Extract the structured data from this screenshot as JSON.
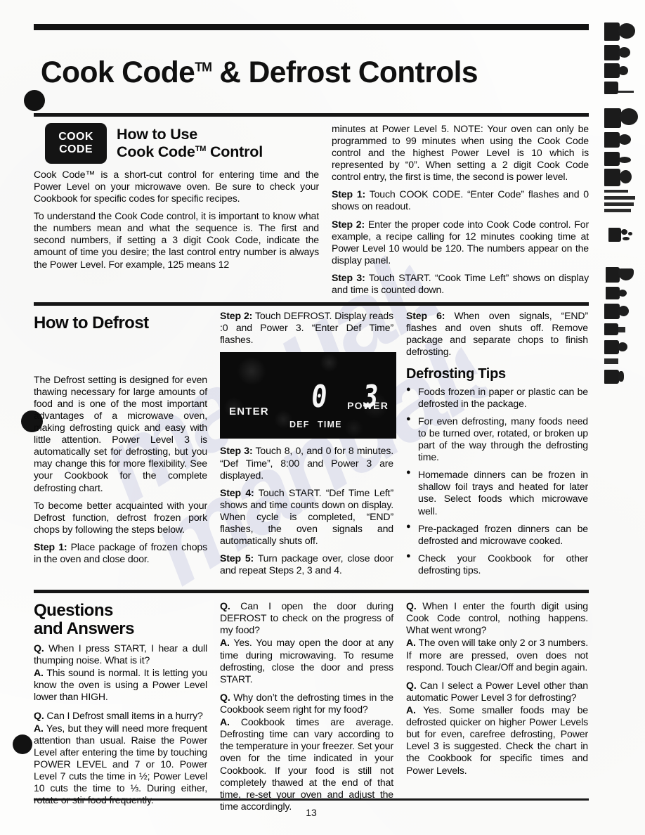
{
  "document": {
    "title": "Cook Code™ & Defrost Controls",
    "title_main_1": "Cook Code",
    "title_tm": "TM",
    "title_main_2": " & Defrost Controls",
    "page_number": "13",
    "watermark_text": "manualslib"
  },
  "cook_code": {
    "badge_line1": "COOK",
    "badge_line2": "CODE",
    "heading_line1": "How to Use",
    "heading_line2": "Cook Code",
    "heading_tm": "TM",
    "heading_line2_tail": " Control",
    "intro_1": "Cook Code™ is a short-cut control for entering time and the Power Level on your microwave oven. Be sure to check your Cookbook for specific codes for specific recipes.",
    "intro_2": "To understand the Cook Code control, it is important to know what the numbers mean and what the sequence is. The first and second numbers, if setting a 3 digit Cook Code, indicate the amount of time you desire; the last control entry number is always the Power Level. For example, 125 means 12",
    "intro_3": "minutes at Power Level 5. NOTE: Your oven can only be programmed to 99 minutes when using the Cook Code control and the highest Power Level is 10 which is represented by “0”. When setting a 2 digit Cook Code control entry, the first is time, the second is power level.",
    "steps": [
      {
        "label": "Step 1:",
        "text": " Touch COOK CODE. “Enter Code” flashes and 0 shows on readout."
      },
      {
        "label": "Step 2:",
        "text": " Enter the proper code into Cook Code control. For example, a recipe calling for 12 minutes cooking time at Power Level 10 would be 120. The numbers appear on the display panel."
      },
      {
        "label": "Step 3:",
        "text": " Touch START. “Cook Time Left” shows on display and time is counted down."
      }
    ]
  },
  "defrost": {
    "heading": "How to Defrost",
    "intro_1": "The Defrost setting is designed for even thawing necessary for large amounts of food and is one of the most important advantages of a microwave oven, making defrosting quick and easy with little attention. Power Level 3 is automatically set for defrosting, but you may change this for more flexibility. See your Cookbook for the complete defrosting chart.",
    "intro_2": "To become better acquainted with your Defrost function, defrost frozen pork chops by following the steps below.",
    "steps": [
      {
        "label": "Step 1:",
        "text": " Place package of frozen chops in the oven and close door."
      },
      {
        "label": "Step 2:",
        "text": " Touch DEFROST. Display reads :0 and Power 3. “Enter Def Time” flashes."
      },
      {
        "label": "Step 3:",
        "text": " Touch 8, 0, and 0 for 8 minutes. “Def Time”, 8:00 and Power 3 are displayed."
      },
      {
        "label": "Step 4:",
        "text": " Touch START. “Def Time Left” shows and time counts down on display. When cycle is completed, “END” flashes, the oven signals and automatically shuts off."
      },
      {
        "label": "Step 5:",
        "text": " Turn package over, close door and repeat Steps 2, 3 and 4."
      },
      {
        "label": "Step 6:",
        "text": " When oven signals, “END” flashes and oven shuts off. Remove package and separate chops to finish defrosting."
      }
    ],
    "display_panel": {
      "enter_label": "ENTER",
      "time_digits": "0",
      "def_label": "DEF",
      "time_label": "TIME",
      "power_digits": "3",
      "power_label": "POWER"
    },
    "tips_heading": "Defrosting Tips",
    "tips": [
      "Foods frozen in paper or plastic can be defrosted in the package.",
      "For even defrosting, many foods need to be turned over, rotated, or broken up part of the way through the defrosting time.",
      "Homemade dinners can be frozen in shallow foil trays and heated for later use. Select foods which microwave well.",
      "Pre-packaged frozen dinners can be defrosted and microwave cooked.",
      "Check your Cookbook for other defrosting tips."
    ]
  },
  "questions": {
    "heading_line1": "Questions",
    "heading_line2": "and Answers",
    "q_prefix": "Q.",
    "a_prefix": "A.",
    "column1": [
      {
        "question": " When I press START, I hear a dull thumping noise. What is it?",
        "answer": " This sound is normal. It is letting you know the oven is using a Power Level lower than HIGH."
      },
      {
        "question": " Can I Defrost small items in a hurry?",
        "answer": " Yes, but they will need more frequent attention than usual. Raise the Power Level after entering the time by touching POWER LEVEL and 7 or 10. Power Level 7 cuts the time in ½; Power Level 10 cuts the time to ⅓. During either, rotate or stir food frequently."
      }
    ],
    "column2": [
      {
        "question": " Can I open the door during DEFROST to check on the progress of my food?",
        "answer": " Yes. You may open the door at any time during microwaving. To resume defrosting, close the door and press START."
      },
      {
        "question": " Why don’t the defrosting times in the Cookbook seem right for my food?",
        "answer": " Cookbook times are average. Defrosting time can vary according to the temperature in your freezer. Set your oven for the time indicated in your Cookbook. If your food is still not completely thawed at the end of that time, re-set your oven and adjust the time accordingly."
      }
    ],
    "column3": [
      {
        "question": " When I enter the fourth digit using Cook Code control, nothing happens. What went wrong?",
        "answer": " The oven will take only 2 or 3 numbers. If more are pressed, oven does not respond. Touch Clear/Off and begin again."
      },
      {
        "question": " Can I select a Power Level other than automatic Power Level 3 for defrosting?",
        "answer": " Yes. Some smaller foods may be defrosted quicker on higher Power Levels but for even, carefree defrosting, Power Level 3 is suggested. Check the chart in the Cookbook for specific times and Power Levels."
      }
    ]
  },
  "colors": {
    "ink": "#101010",
    "paper": "#fdfdfc",
    "led_background": "#0b0b0b",
    "led_text": "#f4f4f4"
  }
}
